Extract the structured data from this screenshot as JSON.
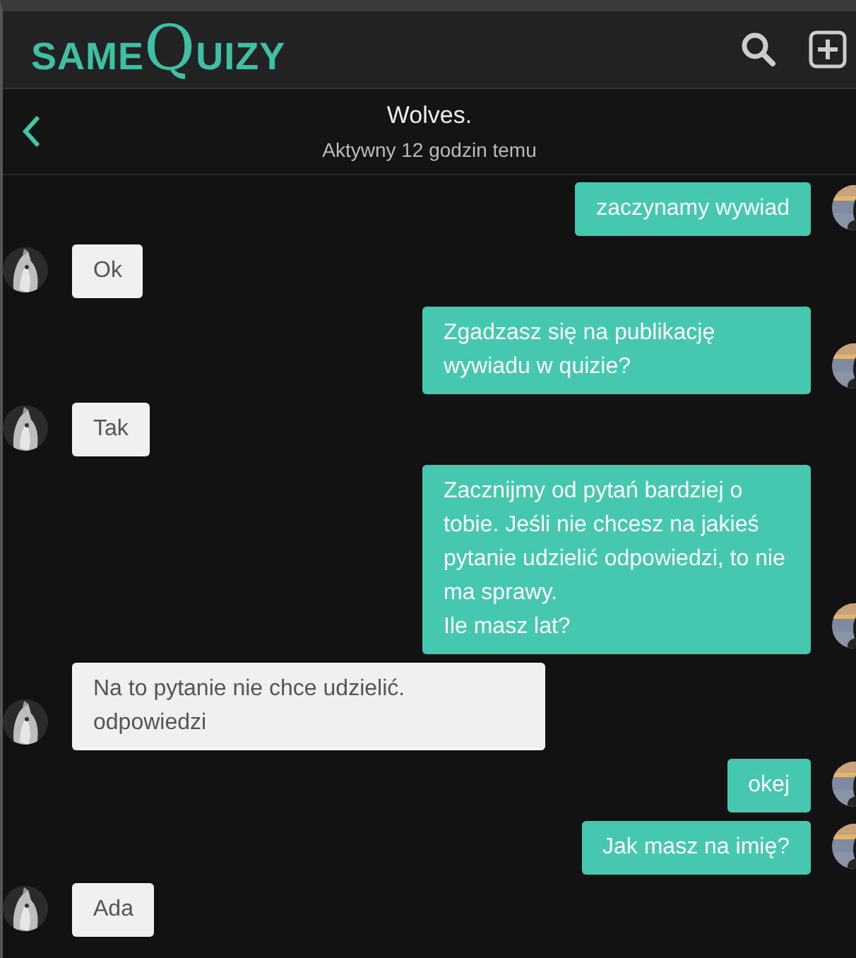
{
  "header": {
    "logo_parts": [
      "SAME",
      "Q",
      "UIZY"
    ]
  },
  "conversation": {
    "name": "Wolves.",
    "status": "Aktywny 12 godzin temu"
  },
  "messages": [
    {
      "kind": "sent",
      "text": "zaczynamy wywiad"
    },
    {
      "kind": "received",
      "text": "Ok"
    },
    {
      "kind": "sent",
      "text": "Zgadzasz się na publikację wywiadu w quizie?"
    },
    {
      "kind": "received",
      "text": "Tak"
    },
    {
      "kind": "sent",
      "text": "Zacznijmy od pytań bardziej o tobie. Jeśli nie chcesz na jakieś pytanie udzielić odpowiedzi, to nie ma sprawy.\nIle masz lat?"
    },
    {
      "kind": "received",
      "text": "Na to pytanie nie chce udzielić. odpowiedzi"
    },
    {
      "kind": "sent",
      "text": "okej"
    },
    {
      "kind": "sent",
      "text": "Jak masz na imię?"
    },
    {
      "kind": "received",
      "text": "Ada"
    }
  ]
}
